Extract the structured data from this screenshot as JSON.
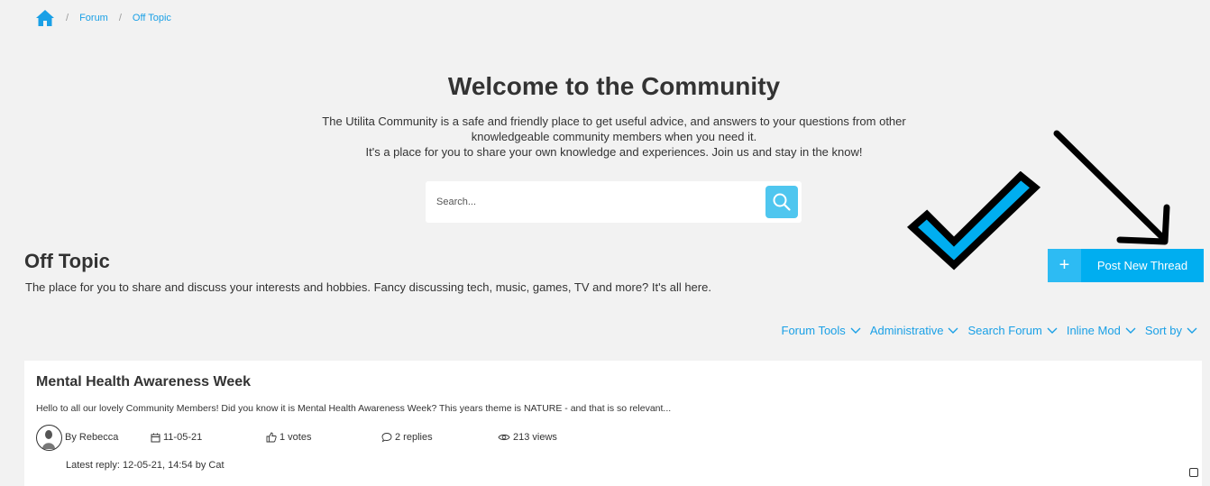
{
  "breadcrumb": {
    "items": [
      "Forum",
      "Off Topic"
    ]
  },
  "hero": {
    "title": "Welcome to the Community",
    "desc_line1": "The Utilita Community is a safe and friendly place to get useful advice, and answers to your questions from other knowledgeable community members when you need it.",
    "desc_line2": "It's a place for you to share your own knowledge and experiences. Join us and stay in the know!"
  },
  "search": {
    "placeholder": "Search..."
  },
  "forum": {
    "title": "Off Topic",
    "description": "The place for you to share and discuss your interests and hobbies. Fancy discussing tech, music, games, TV and more? It's all here."
  },
  "post_button": {
    "plus": "+",
    "label": "Post New Thread"
  },
  "tools": [
    "Forum Tools",
    "Administrative",
    "Search Forum",
    "Inline Mod",
    "Sort by"
  ],
  "thread": {
    "title": "Mental Health Awareness Week",
    "excerpt": "Hello to all our lovely Community Members! Did you know it is Mental Health Awareness Week? This years theme is NATURE - and that is so relevant...",
    "author": "By Rebecca",
    "date": "11-05-21",
    "votes": "1 votes",
    "replies": "2 replies",
    "views": "213 views",
    "latest_reply": "Latest reply: 12-05-21, 14:54 by Cat"
  },
  "colors": {
    "accent": "#00aef0",
    "link": "#1aa0e6",
    "background": "#f2f2f2"
  },
  "icons": {
    "home": "home-icon",
    "search": "search-icon",
    "chevron": "chevron-down-icon",
    "calendar": "calendar-icon",
    "thumb": "thumbs-up-icon",
    "comment": "comment-icon",
    "eye": "eye-icon"
  }
}
